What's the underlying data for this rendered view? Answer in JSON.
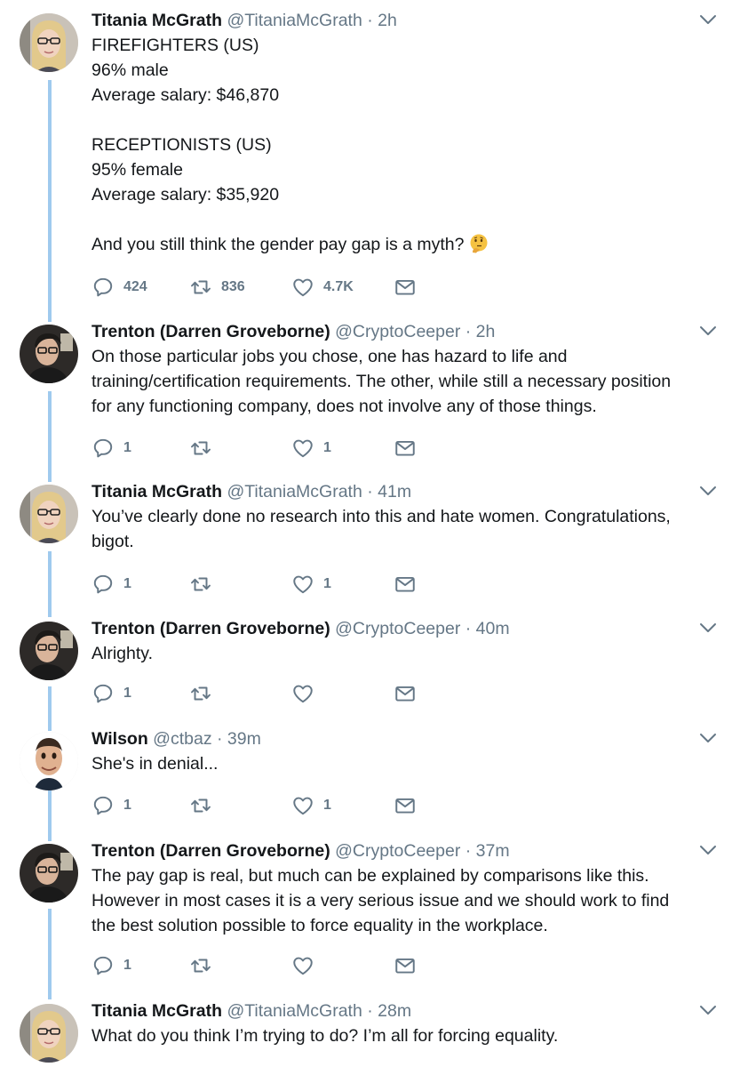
{
  "colors": {
    "thread_line": "#9fcaee",
    "icon_gray": "#657786",
    "text": "#14171a"
  },
  "tweets": [
    {
      "name": "Titania McGrath",
      "handle": "@TitaniaMcGrath",
      "sep": "·",
      "time": "2h",
      "avatar": "titania-avatar",
      "lines": [
        "FIREFIGHTERS (US)",
        "96% male",
        "Average salary: $46,870",
        "",
        "RECEPTIONISTS (US)",
        "95% female",
        "Average salary: $35,920",
        "",
        "And you still think the gender pay gap is a myth?"
      ],
      "emoji": "thinking-face-icon",
      "replies": "424",
      "retweets": "836",
      "likes": "4.7K"
    },
    {
      "name": "Trenton (Darren Groveborne)",
      "handle": "@CryptoCeeper",
      "sep": "·",
      "time": "2h",
      "avatar": "trenton-avatar",
      "lines": [
        "On those particular jobs you chose, one has hazard to life and",
        "training/certification requirements. The other, while still a necessary position",
        "for any functioning company, does not involve any of those things."
      ],
      "replies": "1",
      "retweets": "",
      "likes": "1"
    },
    {
      "name": "Titania McGrath",
      "handle": "@TitaniaMcGrath",
      "sep": "·",
      "time": "41m",
      "avatar": "titania-avatar",
      "lines": [
        "You’ve clearly done no research into this and hate women. Congratulations,",
        "bigot."
      ],
      "replies": "1",
      "retweets": "",
      "likes": "1"
    },
    {
      "name": "Trenton (Darren Groveborne)",
      "handle": "@CryptoCeeper",
      "sep": "·",
      "time": "40m",
      "avatar": "trenton-avatar",
      "lines": [
        "Alrighty."
      ],
      "replies": "1",
      "retweets": "",
      "likes": ""
    },
    {
      "name": "Wilson",
      "handle": "@ctbaz",
      "sep": "·",
      "time": "39m",
      "avatar": "wilson-avatar",
      "lines": [
        "She's in denial..."
      ],
      "replies": "1",
      "retweets": "",
      "likes": "1"
    },
    {
      "name": "Trenton (Darren Groveborne)",
      "handle": "@CryptoCeeper",
      "sep": "·",
      "time": "37m",
      "avatar": "trenton-avatar",
      "lines": [
        "The pay gap is real, but much can be explained by comparisons like this.",
        "However in most cases it is a very serious issue and we should work to find",
        "the best solution possible to force equality in the workplace."
      ],
      "replies": "1",
      "retweets": "",
      "likes": ""
    },
    {
      "name": "Titania McGrath",
      "handle": "@TitaniaMcGrath",
      "sep": "·",
      "time": "28m",
      "avatar": "titania-avatar",
      "lines": [
        "What do you think I’m trying to do? I’m all for forcing equality."
      ]
    }
  ]
}
